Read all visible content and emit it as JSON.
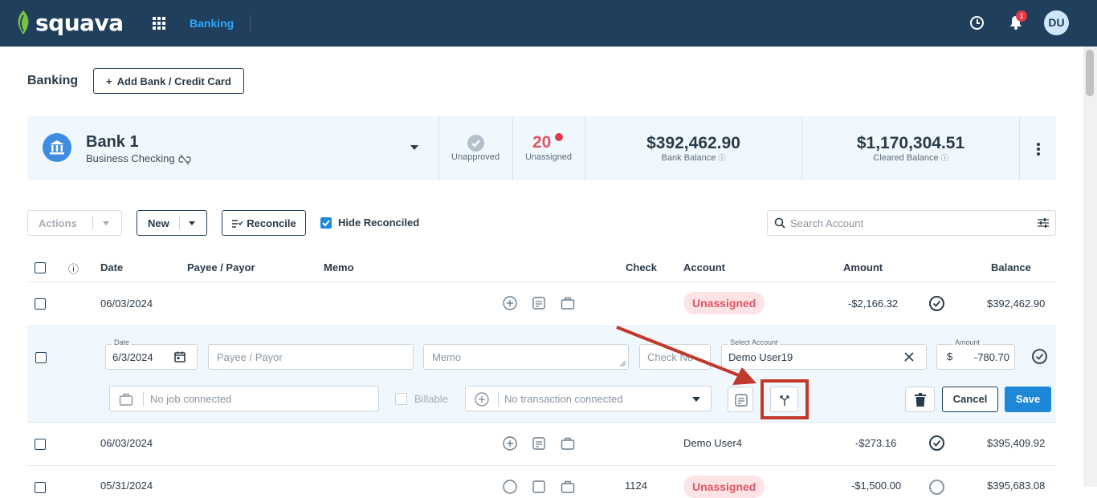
{
  "topbar": {
    "logo_text": "squava",
    "nav_active": "Banking",
    "notification_count": "1",
    "avatar_initials": "DU"
  },
  "page": {
    "title": "Banking",
    "add_bank_label": "Add Bank / Credit Card"
  },
  "bank": {
    "name": "Bank 1",
    "type": "Business Checking",
    "unapproved_label": "Unapproved",
    "unassigned_count": "20",
    "unassigned_label": "Unassigned",
    "bank_balance": "$392,462.90",
    "bank_balance_label": "Bank Balance",
    "cleared_balance": "$1,170,304.51",
    "cleared_balance_label": "Cleared Balance"
  },
  "toolbar": {
    "actions_label": "Actions",
    "new_label": "New",
    "reconcile_label": "Reconcile",
    "hide_reconciled_label": "Hide Reconciled",
    "search_placeholder": "Search Account"
  },
  "table": {
    "headers": {
      "date": "Date",
      "payee": "Payee / Payor",
      "memo": "Memo",
      "check": "Check",
      "account": "Account",
      "amount": "Amount",
      "balance": "Balance"
    },
    "rows": [
      {
        "date": "06/03/2024",
        "check": "",
        "account": "Unassigned",
        "amount": "-$2,166.32",
        "balance": "$392,462.90"
      },
      {
        "date": "06/03/2024",
        "check": "",
        "account": "Demo User4",
        "amount": "-$273.16",
        "balance": "$395,409.92"
      },
      {
        "date": "05/31/2024",
        "check": "1124",
        "account": "Unassigned",
        "amount": "-$1,500.00",
        "balance": "$395,683.08"
      }
    ]
  },
  "edit_row": {
    "date_legend": "Date",
    "date_value": "6/3/2024",
    "payee_placeholder": "Payee / Payor",
    "memo_placeholder": "Memo",
    "check_placeholder": "Check No",
    "account_legend": "Select Account",
    "account_value": "Demo User19",
    "amount_legend": "Amount",
    "currency": "$",
    "amount_value": "-780.70",
    "job_placeholder": "No job connected",
    "billable_label": "Billable",
    "transaction_placeholder": "No transaction connected",
    "cancel_label": "Cancel",
    "save_label": "Save"
  },
  "colors": {
    "topbar": "#1f3f5c",
    "accent": "#1e88d8",
    "danger": "#e05563",
    "annotation": "#c0392b"
  }
}
